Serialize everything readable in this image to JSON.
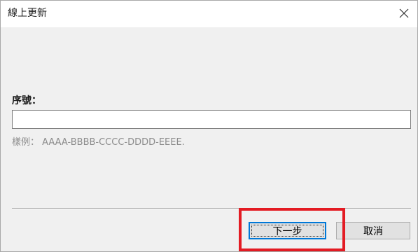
{
  "window": {
    "title": "線上更新",
    "close_icon": "close-icon"
  },
  "form": {
    "serial_label": "序號：",
    "serial_value": "",
    "example_text": "樣例： AAAA-BBBB-CCCC-DDDD-EEEE."
  },
  "buttons": {
    "next_label": "下一步",
    "cancel_label": "取消",
    "next_focused": true
  },
  "colors": {
    "dialog_bg": "#f0f0f0",
    "titlebar_bg": "#ffffff",
    "accent": "#0078d7",
    "highlight": "#e31b23",
    "hint_text": "#8c8c8c"
  }
}
